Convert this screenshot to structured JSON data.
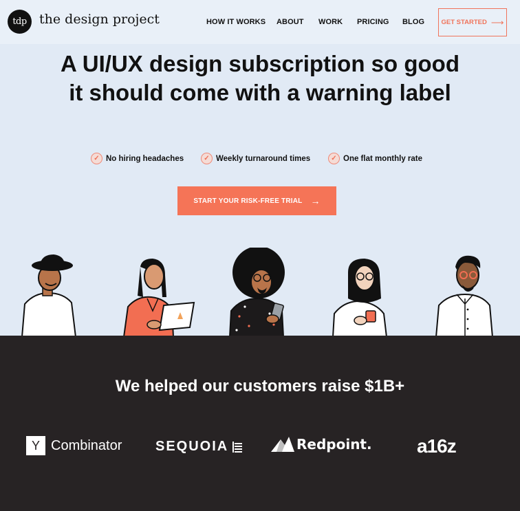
{
  "nav": {
    "logo_badge": "tdp",
    "logo_text": "the design project",
    "links": [
      "HOW IT WORKS",
      "ABOUT",
      "WORK",
      "PRICING",
      "BLOG"
    ],
    "cta_label": "GET STARTED",
    "cta_icon": "arrow-right-icon"
  },
  "hero": {
    "headline": "A UI/UX design subscription so good it should come with a warning label",
    "features": [
      "No hiring headaches",
      "Weekly turnaround times",
      "One flat monthly rate"
    ],
    "feature_icon": "check-circle-icon",
    "cta_label": "START YOUR RISK-FREE TRIAL",
    "cta_icon": "arrow-right-icon"
  },
  "investors": {
    "title": "We helped our customers raise $1B+",
    "logos": {
      "ycombinator_box": "Y",
      "ycombinator_text": "Combinator",
      "sequoia_text": "SEQUOIA",
      "redpoint_text": "Redpoint.",
      "a16z_text": "a16z"
    }
  },
  "colors": {
    "accent": "#f57457",
    "hero_bg": "#e1eaf5",
    "dark_bg": "#272324"
  }
}
